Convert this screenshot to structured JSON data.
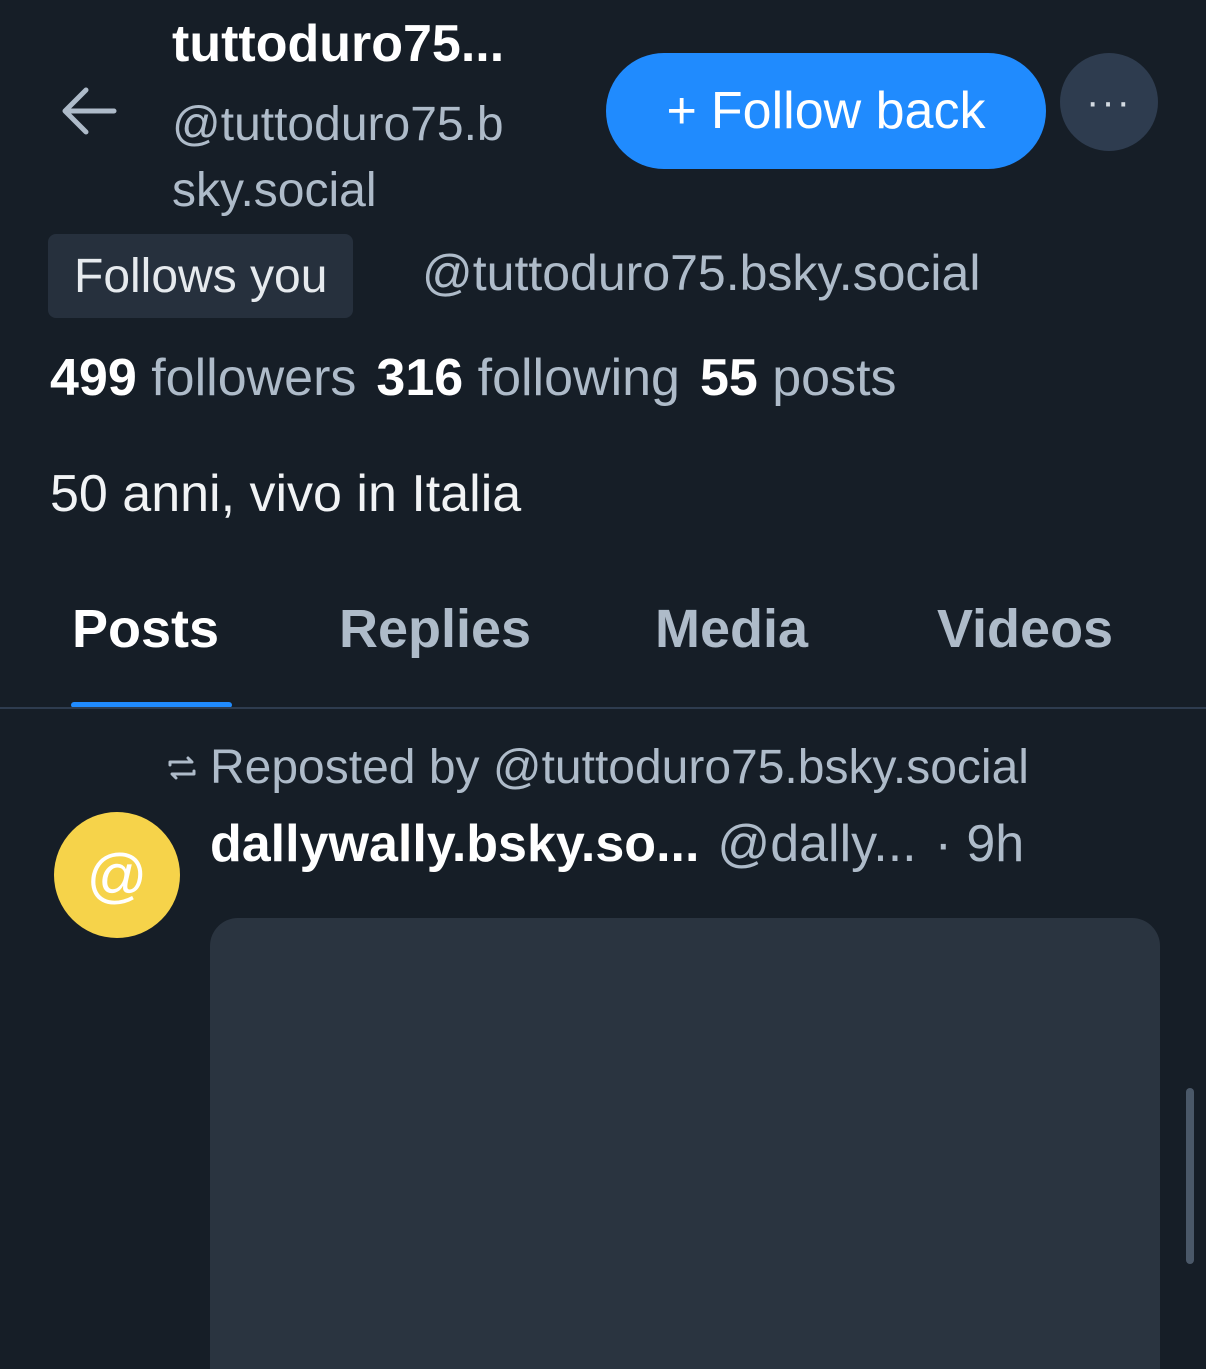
{
  "header": {
    "display_name": "tuttoduro75...",
    "handle_line1": "@tuttoduro75.b",
    "handle_line2": "sky.social",
    "follow_label": "Follow back",
    "follow_icon": "+",
    "more_icon": "···"
  },
  "profile": {
    "follows_you": "Follows you",
    "handle": "@tuttoduro75.bsky.social",
    "followers_count": "499",
    "followers_label": "followers",
    "following_count": "316",
    "following_label": "following",
    "posts_count": "55",
    "posts_label": "posts",
    "bio": "50 anni, vivo in Italia"
  },
  "tabs": [
    {
      "label": "Posts",
      "active": true
    },
    {
      "label": "Replies",
      "active": false
    },
    {
      "label": "Media",
      "active": false
    },
    {
      "label": "Videos",
      "active": false
    }
  ],
  "post": {
    "repost_label": "Reposted by @tuttoduro75.bsky.social",
    "author": "dallywally.bsky.so...",
    "handle": "@dally...",
    "time": "· 9h",
    "avatar_glyph": "@",
    "avatar_color": "#f6d34a"
  },
  "colors": {
    "accent": "#208bfe",
    "background": "#161e27"
  }
}
